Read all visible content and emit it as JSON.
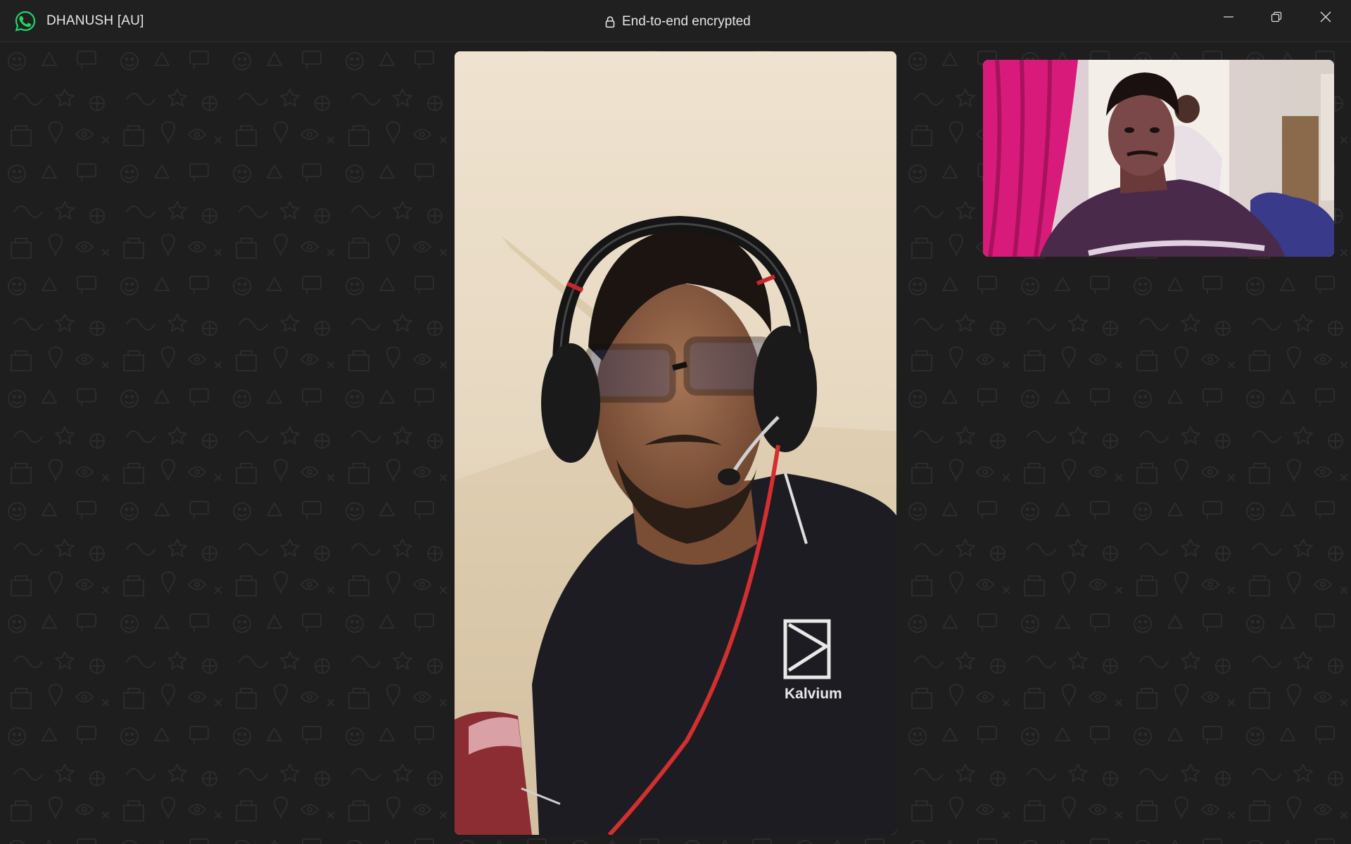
{
  "app": {
    "name": "WhatsApp",
    "icon": "whatsapp-logo-icon",
    "accent_color": "#25d366"
  },
  "titlebar": {
    "contact_name": "DHANUSH [AU]",
    "encryption_label": "End-to-end encrypted",
    "encryption_icon": "lock-icon",
    "controls": {
      "minimize_icon": "minimize-icon",
      "restore_icon": "restore-icon",
      "close_icon": "close-icon"
    }
  },
  "call": {
    "type": "video",
    "main_video": {
      "description_icon": "remote-participant-video",
      "shirt_logo_text": "Kalvium"
    },
    "self_preview": {
      "description_icon": "self-camera-preview"
    },
    "background_color": "#1e1e1e"
  }
}
